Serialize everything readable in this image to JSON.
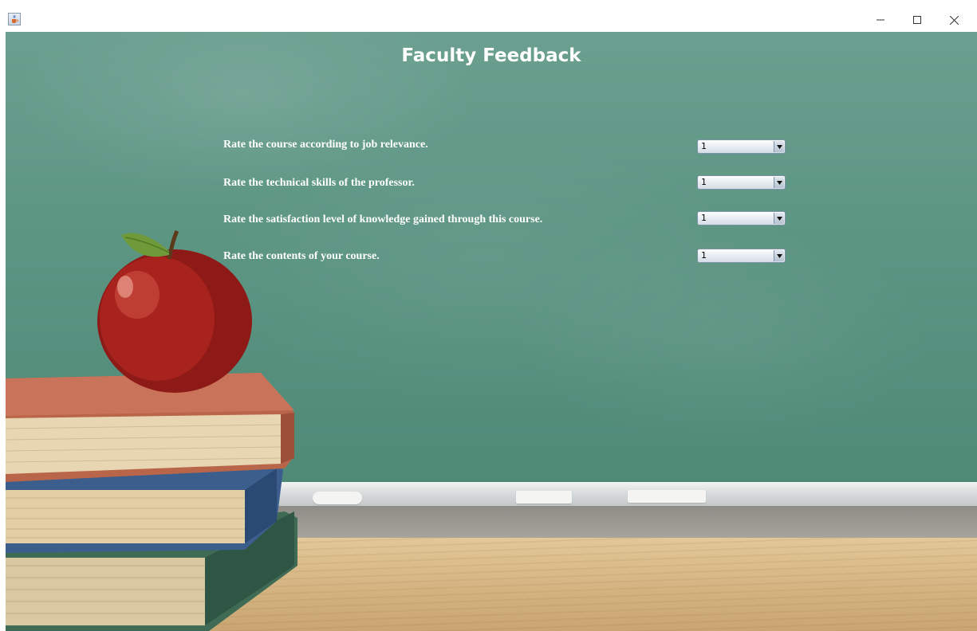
{
  "window": {
    "app_icon": "java-cup-icon",
    "controls": {
      "minimize": "minimize-icon",
      "maximize": "maximize-icon",
      "close": "close-icon"
    }
  },
  "form": {
    "title": "Faculty Feedback",
    "questions": [
      {
        "label": "Rate the course according to job relevance.",
        "selected": "1"
      },
      {
        "label": "Rate the technical skills of the professor.",
        "selected": "1"
      },
      {
        "label": "Rate the satisfaction level of knowledge gained through this course.",
        "selected": "1"
      },
      {
        "label": "Rate the contents of your course.",
        "selected": "1"
      }
    ]
  },
  "colors": {
    "chalkboard": "#5e9684",
    "text": "#ffffff"
  }
}
